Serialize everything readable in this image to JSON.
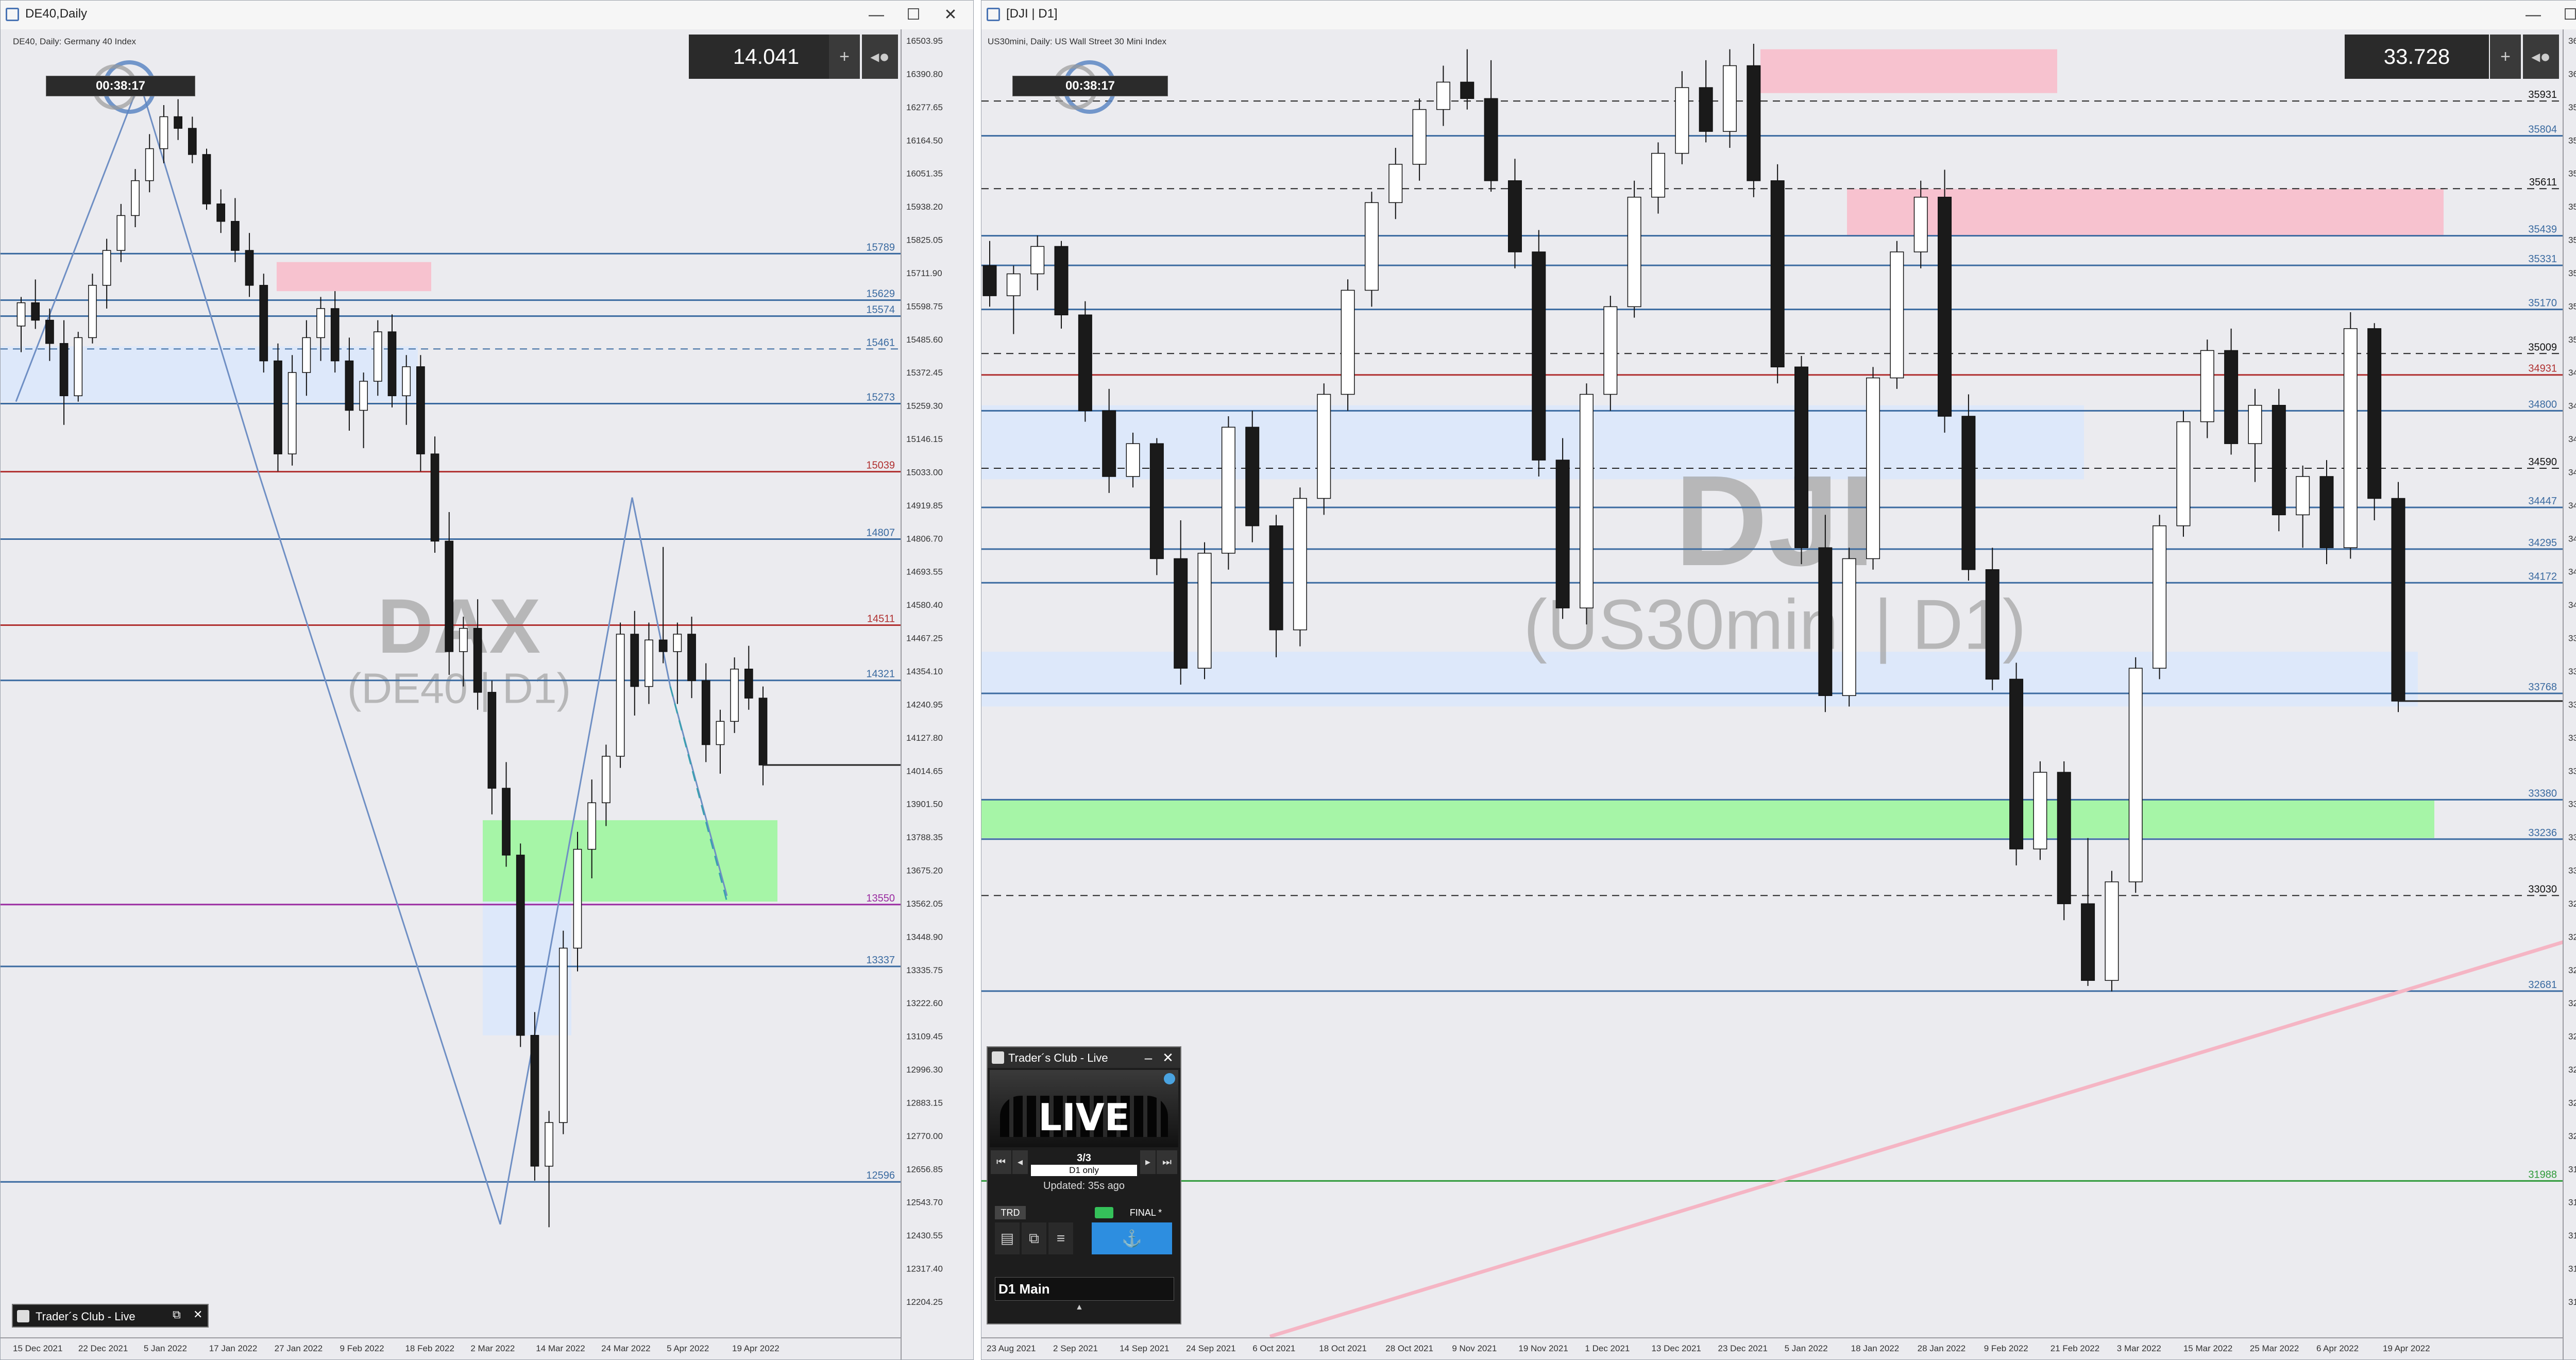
{
  "colors": {
    "up": "#ffffff",
    "down": "#1a1a1a",
    "blue_line": "#3a6aa0",
    "red_line": "#b03030",
    "pink_zone": "#f8c0cc",
    "blue_zone": "#dce8fb",
    "green_zone": "#a2f5a2",
    "trend_pink": "#f5b5c4",
    "zigzag": "#6f8fc4",
    "watermark": "#a6a6a6"
  },
  "left": {
    "title": "DE40,Daily",
    "controls": [
      "—",
      "☐",
      "✕"
    ],
    "instrument": "DE40, Daily:  Germany 40 Index",
    "timer": "00:38:17",
    "price_box": "14.041",
    "watermark_main": "DAX",
    "watermark_sub": "(DE40 | D1)",
    "panel_title": "Trader´s Club - Live",
    "chart_data": {
      "type": "candlestick",
      "instrument": "DE40",
      "timeframe": "Daily",
      "x": [
        "15 Dec 2021",
        "22 Dec 2021",
        "5 Jan 2022",
        "17 Jan 2022",
        "27 Jan 2022",
        "9 Feb 2022",
        "18 Feb 2022",
        "2 Mar 2022",
        "14 Mar 2022",
        "24 Mar 2022",
        "5 Apr 2022",
        "19 Apr 2022"
      ],
      "ylim": [
        12148,
        16525
      ],
      "y_ticks": [
        "16503.95",
        "16390.80",
        "16277.65",
        "16164.50",
        "16051.35",
        "15938.20",
        "15825.05",
        "15711.90",
        "15598.75",
        "15485.60",
        "15372.45",
        "15259.30",
        "15146.15",
        "15033.00",
        "14919.85",
        "14806.70",
        "14693.55",
        "14580.40",
        "14467.25",
        "14354.10",
        "14240.95",
        "14127.80",
        "14014.65",
        "13901.50",
        "13788.35",
        "13675.20",
        "13562.05",
        "13448.90",
        "13335.75",
        "13222.60",
        "13109.45",
        "12996.30",
        "12883.15",
        "12770.00",
        "12656.85",
        "12543.70",
        "12430.55",
        "12317.40",
        "12204.25"
      ],
      "levels": [
        {
          "label": "15789",
          "value": 15789,
          "color": "blue"
        },
        {
          "label": "15629",
          "value": 15629,
          "color": "blue"
        },
        {
          "label": "15574",
          "value": 15574,
          "color": "blue"
        },
        {
          "label": "15461",
          "value": 15461,
          "color": "blue-dashed"
        },
        {
          "label": "15273",
          "value": 15273,
          "color": "blue"
        },
        {
          "label": "15039",
          "value": 15039,
          "color": "red"
        },
        {
          "label": "14807",
          "value": 14807,
          "color": "blue"
        },
        {
          "label": "14511",
          "value": 14511,
          "color": "red"
        },
        {
          "label": "14321",
          "value": 14321,
          "color": "blue"
        },
        {
          "label": "13550",
          "value": 13550,
          "color": "purple"
        },
        {
          "label": "13337",
          "value": 13337,
          "color": "blue"
        },
        {
          "label": "12596",
          "value": 12596,
          "color": "blue"
        }
      ],
      "candles_ohlc": [
        [
          15540,
          15640,
          15450,
          15620
        ],
        [
          15620,
          15700,
          15530,
          15560
        ],
        [
          15560,
          15600,
          15420,
          15480
        ],
        [
          15480,
          15560,
          15200,
          15300
        ],
        [
          15300,
          15520,
          15280,
          15500
        ],
        [
          15500,
          15720,
          15480,
          15680
        ],
        [
          15680,
          15840,
          15600,
          15800
        ],
        [
          15800,
          15960,
          15760,
          15920
        ],
        [
          15920,
          16080,
          15880,
          16040
        ],
        [
          16040,
          16200,
          16000,
          16150
        ],
        [
          16150,
          16300,
          16100,
          16260
        ],
        [
          16260,
          16320,
          16180,
          16220
        ],
        [
          16220,
          16260,
          16100,
          16130
        ],
        [
          16130,
          16150,
          15940,
          15960
        ],
        [
          15960,
          16010,
          15860,
          15900
        ],
        [
          15900,
          15980,
          15760,
          15800
        ],
        [
          15800,
          15860,
          15640,
          15680
        ],
        [
          15680,
          15720,
          15380,
          15420
        ],
        [
          15420,
          15480,
          15040,
          15100
        ],
        [
          15100,
          15440,
          15060,
          15380
        ],
        [
          15380,
          15560,
          15300,
          15500
        ],
        [
          15500,
          15640,
          15420,
          15600
        ],
        [
          15600,
          15660,
          15380,
          15420
        ],
        [
          15420,
          15500,
          15180,
          15250
        ],
        [
          15250,
          15380,
          15120,
          15350
        ],
        [
          15350,
          15560,
          15300,
          15520
        ],
        [
          15520,
          15580,
          15260,
          15300
        ],
        [
          15300,
          15440,
          15200,
          15400
        ],
        [
          15400,
          15440,
          15040,
          15100
        ],
        [
          15100,
          15160,
          14760,
          14800
        ],
        [
          14800,
          14900,
          14340,
          14420
        ],
        [
          14420,
          14540,
          14300,
          14500
        ],
        [
          14500,
          14600,
          14220,
          14280
        ],
        [
          14280,
          14320,
          13860,
          13950
        ],
        [
          13950,
          14040,
          13680,
          13720
        ],
        [
          13720,
          13760,
          13060,
          13100
        ],
        [
          13100,
          13180,
          12600,
          12650
        ],
        [
          12650,
          12840,
          12440,
          12800
        ],
        [
          12800,
          13460,
          12760,
          13400
        ],
        [
          13400,
          13800,
          13320,
          13740
        ],
        [
          13740,
          13980,
          13640,
          13900
        ],
        [
          13900,
          14100,
          13820,
          14060
        ],
        [
          14060,
          14520,
          14020,
          14480
        ],
        [
          14480,
          14560,
          14200,
          14300
        ],
        [
          14300,
          14520,
          14240,
          14460
        ],
        [
          14460,
          14780,
          14380,
          14420
        ],
        [
          14420,
          14520,
          14240,
          14480
        ],
        [
          14480,
          14540,
          14260,
          14320
        ],
        [
          14320,
          14380,
          14040,
          14100
        ],
        [
          14100,
          14220,
          14000,
          14180
        ],
        [
          14180,
          14400,
          14140,
          14360
        ],
        [
          14360,
          14440,
          14220,
          14260
        ],
        [
          14260,
          14300,
          13960,
          14030
        ]
      ]
    }
  },
  "right": {
    "title": "[DJI | D1]",
    "controls": [
      "—",
      "☐",
      "✕"
    ],
    "instrument": "US30mini, Daily:  US Wall Street 30 Mini Index",
    "timer": "00:38:17",
    "price_box": "33.728",
    "watermark_main": "DJI",
    "watermark_sub": "(US30mini | D1)",
    "panel_title": "Trader´s Club - Live",
    "panel_live": "LIVE",
    "panel_counter": "3/3",
    "panel_filter": "D1 only",
    "panel_updated": "Updated: 35s ago",
    "panel_trd": "TRD",
    "panel_final": "FINAL *",
    "panel_main": "D1 Main",
    "chart_data": {
      "type": "candlestick",
      "instrument": "US30mini",
      "timeframe": "Daily",
      "x": [
        "23 Aug 2021",
        "2 Sep 2021",
        "14 Sep 2021",
        "24 Sep 2021",
        "6 Oct 2021",
        "18 Oct 2021",
        "28 Oct 2021",
        "9 Nov 2021",
        "19 Nov 2021",
        "1 Dec 2021",
        "13 Dec 2021",
        "23 Dec 2021",
        "5 Jan 2022",
        "18 Jan 2022",
        "28 Jan 2022",
        "9 Feb 2022",
        "21 Feb 2022",
        "3 Mar 2022",
        "15 Mar 2022",
        "25 Mar 2022",
        "6 Apr 2022",
        "19 Apr 2022"
      ],
      "ylim": [
        31415,
        36155
      ],
      "y_ticks": [
        "36125.00",
        "36003.35",
        "35880.70",
        "35758.05",
        "35635.40",
        "35512.75",
        "35390.10",
        "35267.45",
        "35144.80",
        "35022.15",
        "34899.50",
        "34776.85",
        "34654.20",
        "34531.55",
        "34408.90",
        "34286.25",
        "34163.60",
        "34040.95",
        "33918.30",
        "33795.65",
        "33675.00",
        "33553.35",
        "33430.70",
        "33308.05",
        "33185.40",
        "33062.75",
        "32940.10",
        "32818.45",
        "32695.80",
        "32573.15",
        "32450.50",
        "32327.85",
        "32205.20",
        "32082.55",
        "31959.90",
        "31837.25",
        "31715.60",
        "31592.95",
        "31470.30"
      ],
      "levels": [
        {
          "label": "35931",
          "value": 35931,
          "color": "black-dashed"
        },
        {
          "label": "35804",
          "value": 35804,
          "color": "blue"
        },
        {
          "label": "35611",
          "value": 35611,
          "color": "black-dashed"
        },
        {
          "label": "35439",
          "value": 35439,
          "color": "blue"
        },
        {
          "label": "35331",
          "value": 35331,
          "color": "blue"
        },
        {
          "label": "35170",
          "value": 35170,
          "color": "blue"
        },
        {
          "label": "35009",
          "value": 35009,
          "color": "black-dashed"
        },
        {
          "label": "34931",
          "value": 34931,
          "color": "red"
        },
        {
          "label": "34800",
          "value": 34800,
          "color": "blue"
        },
        {
          "label": "34590",
          "value": 34590,
          "color": "black-dashed"
        },
        {
          "label": "34447",
          "value": 34447,
          "color": "blue"
        },
        {
          "label": "34295",
          "value": 34295,
          "color": "blue"
        },
        {
          "label": "34172",
          "value": 34172,
          "color": "blue"
        },
        {
          "label": "33768",
          "value": 33768,
          "color": "blue"
        },
        {
          "label": "33380",
          "value": 33380,
          "color": "blue"
        },
        {
          "label": "33236",
          "value": 33236,
          "color": "blue"
        },
        {
          "label": "33030",
          "value": 33030,
          "color": "black-dashed"
        },
        {
          "label": "32681",
          "value": 32681,
          "color": "blue"
        },
        {
          "label": "31988",
          "value": 31988,
          "color": "green"
        }
      ],
      "candles_ohlc": [
        [
          35330,
          35420,
          35180,
          35220
        ],
        [
          35220,
          35330,
          35080,
          35300
        ],
        [
          35300,
          35440,
          35240,
          35400
        ],
        [
          35400,
          35420,
          35100,
          35150
        ],
        [
          35150,
          35200,
          34760,
          34800
        ],
        [
          34800,
          34880,
          34500,
          34560
        ],
        [
          34560,
          34720,
          34520,
          34680
        ],
        [
          34680,
          34700,
          34200,
          34260
        ],
        [
          34260,
          34400,
          33800,
          33860
        ],
        [
          33860,
          34320,
          33820,
          34280
        ],
        [
          34280,
          34780,
          34220,
          34740
        ],
        [
          34740,
          34800,
          34320,
          34380
        ],
        [
          34380,
          34420,
          33900,
          34000
        ],
        [
          34000,
          34520,
          33940,
          34480
        ],
        [
          34480,
          34900,
          34420,
          34860
        ],
        [
          34860,
          35280,
          34800,
          35240
        ],
        [
          35240,
          35600,
          35180,
          35560
        ],
        [
          35560,
          35760,
          35500,
          35700
        ],
        [
          35700,
          35940,
          35640,
          35900
        ],
        [
          35900,
          36060,
          35840,
          36000
        ],
        [
          36000,
          36120,
          35900,
          35940
        ],
        [
          35940,
          36080,
          35600,
          35640
        ],
        [
          35640,
          35720,
          35320,
          35380
        ],
        [
          35380,
          35460,
          34560,
          34620
        ],
        [
          34620,
          34700,
          34040,
          34080
        ],
        [
          34080,
          34900,
          34020,
          34860
        ],
        [
          34860,
          35220,
          34800,
          35180
        ],
        [
          35180,
          35640,
          35140,
          35580
        ],
        [
          35580,
          35780,
          35520,
          35740
        ],
        [
          35740,
          36040,
          35700,
          35980
        ],
        [
          35980,
          36080,
          35780,
          35820
        ],
        [
          35820,
          36120,
          35760,
          36060
        ],
        [
          36060,
          36140,
          35580,
          35640
        ],
        [
          35640,
          35700,
          34900,
          34960
        ],
        [
          34960,
          35000,
          34240,
          34300
        ],
        [
          34300,
          34420,
          33700,
          33760
        ],
        [
          33760,
          34300,
          33720,
          34260
        ],
        [
          34260,
          34960,
          34220,
          34920
        ],
        [
          34920,
          35420,
          34880,
          35380
        ],
        [
          35380,
          35640,
          35320,
          35580
        ],
        [
          35580,
          35680,
          34720,
          34780
        ],
        [
          34780,
          34860,
          34180,
          34220
        ],
        [
          34220,
          34300,
          33780,
          33820
        ],
        [
          33820,
          33880,
          33140,
          33200
        ],
        [
          33200,
          33520,
          33160,
          33480
        ],
        [
          33480,
          33520,
          32940,
          33000
        ],
        [
          33000,
          33240,
          32700,
          32720
        ],
        [
          32720,
          33120,
          32680,
          33080
        ],
        [
          33080,
          33900,
          33040,
          33860
        ],
        [
          33860,
          34420,
          33820,
          34380
        ],
        [
          34380,
          34800,
          34340,
          34760
        ],
        [
          34760,
          35060,
          34700,
          35020
        ],
        [
          35020,
          35100,
          34640,
          34680
        ],
        [
          34680,
          34880,
          34540,
          34820
        ],
        [
          34820,
          34880,
          34360,
          34420
        ],
        [
          34420,
          34600,
          34300,
          34560
        ],
        [
          34560,
          34620,
          34240,
          34300
        ],
        [
          34300,
          35160,
          34260,
          35100
        ],
        [
          35100,
          35120,
          34400,
          34480
        ],
        [
          34480,
          34540,
          33700,
          33740
        ]
      ]
    }
  }
}
